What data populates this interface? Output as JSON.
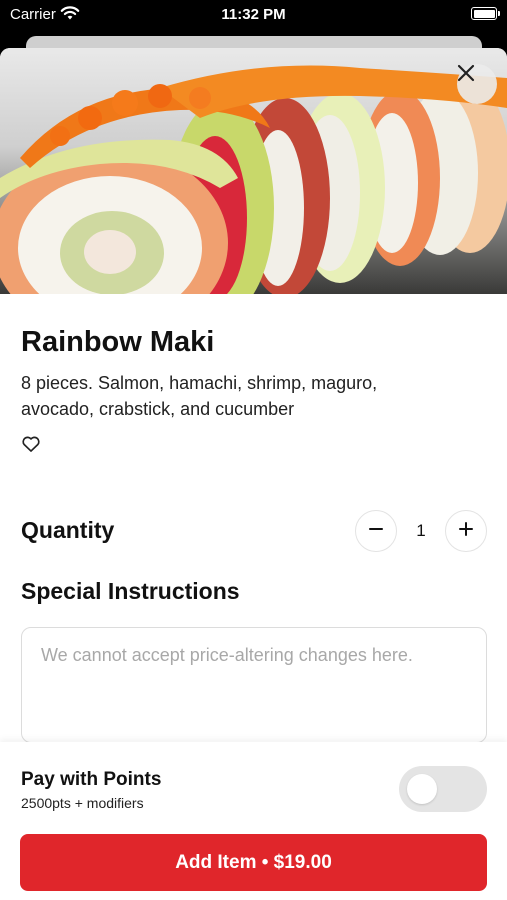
{
  "status_bar": {
    "carrier": "Carrier",
    "time": "11:32 PM"
  },
  "item": {
    "name": "Rainbow Maki",
    "description": "8 pieces. Salmon, hamachi, shrimp, maguro, avocado, crabstick, and cucumber",
    "favorited": false,
    "image_icon": "sushi-photo"
  },
  "quantity": {
    "label": "Quantity",
    "value": "1"
  },
  "special_instructions": {
    "label": "Special Instructions",
    "placeholder": "We cannot accept price-altering changes here.",
    "value": ""
  },
  "points": {
    "title": "Pay with Points",
    "subtitle": "2500pts + modifiers",
    "enabled": false
  },
  "add_button": {
    "label": "Add Item • $19.00"
  },
  "colors": {
    "accent": "#e0262b",
    "toggle_off": "#e4e4e4"
  }
}
